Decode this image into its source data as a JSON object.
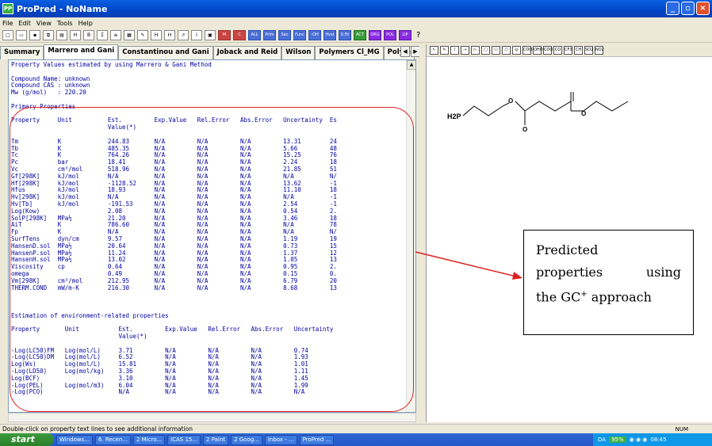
{
  "window": {
    "title": "ProPred - NoName"
  },
  "menu": [
    "File",
    "Edit",
    "View",
    "Tools",
    "Help"
  ],
  "toolbar": {
    "buttons": [
      "new",
      "open",
      "save",
      "copy",
      "paste",
      "Hvap",
      "bold",
      "sum",
      "sort",
      "chart",
      "tools",
      "Hfus",
      "Hvap",
      "trend",
      "graph",
      "print",
      "Mw",
      "crit"
    ],
    "labelled": [
      "ALL",
      "Prim",
      "Sec",
      "Func",
      "-OH",
      "Hvst",
      "0.Fit",
      "ACT",
      "ORG",
      "POL",
      "LIP"
    ],
    "help": "?"
  },
  "tabs": [
    "Summary",
    "Marrero and Gani",
    "Constantinou and Gani",
    "Joback and Reid",
    "Wilson",
    "Polymers Cl_MG",
    "Polym"
  ],
  "content_lines": [
    "Property Values estimated by using Marrero & Gani Method",
    "",
    "Compound Name: unknown",
    "Compound CAS : unknown",
    "Mw (g/mol)   : 220.20",
    "",
    "Primary Properties",
    "",
    "Property     Unit          Est.         Exp.Value   Rel.Error   Abs.Error   Uncertainty  Es",
    "                           Value(*)",
    "",
    "Tm           K             244.83       N/A         N/A         N/A         13.31        24",
    "Tb           K             485.35       N/A         N/A         N/A         5.66         48",
    "Tc           K             764.26       N/A         N/A         N/A         15.25        76",
    "Pc           bar           18.41        N/A         N/A         N/A         2.24         18",
    "Vc           cm³/mol       518.96       N/A         N/A         N/A         21.85        51",
    "Gf[298K]     kJ/mol        N/A          N/A         N/A         N/A         N/A          N/",
    "Hf[298K]     kJ/mol        -1128.52     N/A         N/A         N/A         13.62        -1",
    "Hfus         kJ/mol        18.93        N/A         N/A         N/A         11.10        18",
    "Hv[298K]     kJ/mol        N/A          N/A         N/A         N/A         N/A          -1",
    "Hv[Tb]       kJ/mol        -191.53      N/A         N/A         N/A         2.54         -1",
    "Log(Kow)                   2.08         N/A         N/A         N/A         0.54         2.",
    "SolP[298K]   MPa½          21.20        N/A         N/A         N/A         3.46         18",
    "AiT          K             786.60       N/A         N/A         N/A         N/A          78",
    "Fp           K             N/A          N/A         N/A         N/A         N/A          N/",
    "SurfTens     dyn/cm        9.57         N/A         N/A         N/A         1.19         19",
    "HansenD.sol  MPa½          20.64        N/A         N/A         N/A         0.73         15",
    "HansenP.sol  MPa½          11.24        N/A         N/A         N/A         1.37         12",
    "HansenH.sol  MPa½          13.02        N/A         N/A         N/A         1.05         13",
    "Viscosity    cp            0.64         N/A         N/A         N/A         0.95         2.",
    "omega                      0.49         N/A         N/A         N/A         0.15         0.",
    "Vm[298K]     cm³/mol       212.95       N/A         N/A         N/A         6.79         20",
    "THERM.COND   mW/m-K        216.30       N/A         N/A         N/A         8.68         13",
    "",
    "",
    "",
    "Estimation of environment-related properties",
    "",
    "Property       Unit           Est.         Exp.Value   Rel.Error   Abs.Error   Uncertainty",
    "                              Value(*)",
    "",
    "-Log(LC50)FM   Log(mol/L)     3.71         N/A         N/A         N/A         0.74",
    "-Log(LC50)DM   Log(mol/L)     6.52         N/A         N/A         N/A         1.93",
    "Log(Ws)        Log(mol/L)     15.81        N/A         N/A         N/A         1.01",
    "-Log(LD50)     Log(mol/kg)    3.36         N/A         N/A         N/A         1.11",
    "Log(BCF)                      3.10         N/A         N/A         N/A         1.45",
    "-Log(PEL)      Log(mol/m3)    6.04         N/A         N/A         N/A         1.99",
    "-Log(PCO)                     N/A          N/A         N/A         N/A         N/A"
  ],
  "draw_tools": [
    "select",
    "pencil",
    "line",
    "arrow",
    "rect",
    "pent",
    "hex",
    "ring",
    "COOH",
    "OHO",
    "COO",
    "CO",
    "CF3",
    "CH",
    "SO2",
    "NO2"
  ],
  "molecule": {
    "labels": [
      "H2P",
      "O",
      "O",
      "O",
      "O"
    ]
  },
  "callout": {
    "line1": "Predicted",
    "line2a": "properties",
    "line2b": "using",
    "line3": "the GC",
    "sup": "+",
    "line3b": " approach"
  },
  "status": {
    "text": "Double-click on property text lines to see additional information",
    "num": "NUM"
  },
  "taskbar": {
    "start": "start",
    "items": [
      "Windows...",
      "6. Recen...",
      "2 Micro...",
      "ICAS 15...",
      "2 Paint",
      "2 Goog...",
      "Inbox - ...",
      "ProPred ..."
    ],
    "lang": "DA",
    "zoom": "95%",
    "time": "08:45"
  }
}
